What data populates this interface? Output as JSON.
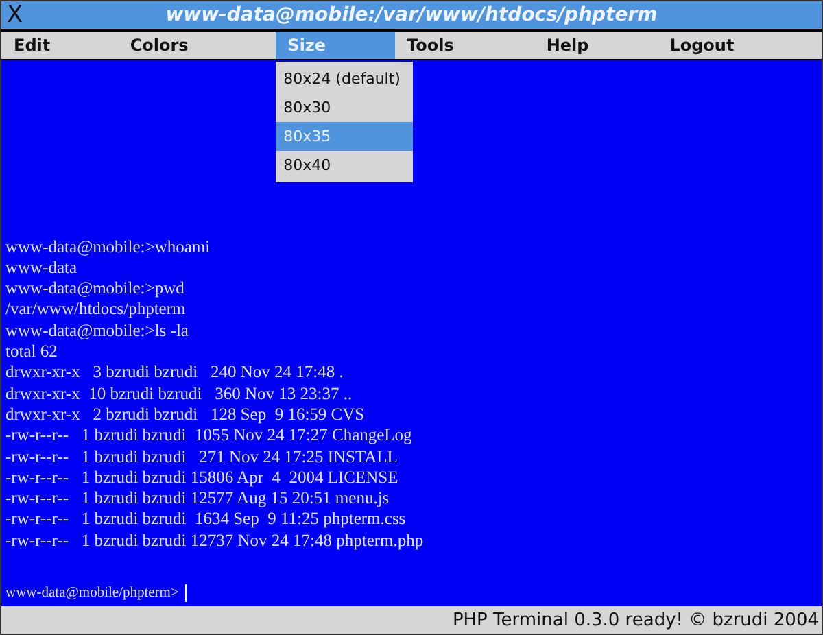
{
  "window": {
    "title": "www-data@mobile:/var/www/htdocs/phpterm",
    "close_label": "X"
  },
  "menu": [
    {
      "label": "Edit",
      "selected": false
    },
    {
      "label": "Colors",
      "selected": false
    },
    {
      "label": "Size",
      "selected": true,
      "expanded": true,
      "items": [
        {
          "label": "80x24 (default)",
          "selected": false
        },
        {
          "label": "80x30",
          "selected": false
        },
        {
          "label": "80x35",
          "selected": true
        },
        {
          "label": "80x40",
          "selected": false
        }
      ]
    },
    {
      "label": "Tools",
      "selected": false
    },
    {
      "label": "Help",
      "selected": false
    },
    {
      "label": "Logout",
      "selected": false
    }
  ],
  "terminal": {
    "lines": [
      "www-data@mobile:>whoami",
      "www-data",
      "www-data@mobile:>pwd",
      "/var/www/htdocs/phpterm",
      "www-data@mobile:>ls -la",
      "total 62",
      "drwxr-xr-x   3 bzrudi bzrudi   240 Nov 24 17:48 .",
      "drwxr-xr-x  10 bzrudi bzrudi   360 Nov 13 23:37 ..",
      "drwxr-xr-x   2 bzrudi bzrudi   128 Sep  9 16:59 CVS",
      "-rw-r--r--   1 bzrudi bzrudi  1055 Nov 24 17:27 ChangeLog",
      "-rw-r--r--   1 bzrudi bzrudi   271 Nov 24 17:25 INSTALL",
      "-rw-r--r--   1 bzrudi bzrudi 15806 Apr  4  2004 LICENSE",
      "-rw-r--r--   1 bzrudi bzrudi 12577 Aug 15 20:51 menu.js",
      "-rw-r--r--   1 bzrudi bzrudi  1634 Sep  9 11:25 phpterm.css",
      "-rw-r--r--   1 bzrudi bzrudi 12737 Nov 24 17:48 phpterm.php"
    ],
    "prompt": "www-data@mobile/phpterm>"
  },
  "status_bar": "PHP Terminal 0.3.0 ready! © bzrudi 2004"
}
